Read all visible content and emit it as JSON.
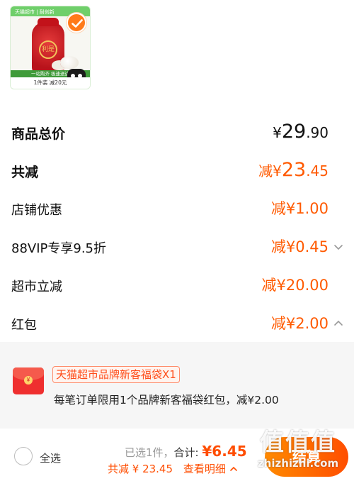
{
  "product": {
    "thumb_top_text": "天猫超市 | 耐创新",
    "thumb_seal_text": "利是",
    "thumb_band_text": "一站购齐 极速送达",
    "thumb_bottom_text": "1件装 减20元"
  },
  "summary_rows": [
    {
      "label": "商品总价",
      "currency": "¥",
      "amount_int": "29",
      "amount_dec": ".90"
    },
    {
      "label": "共减",
      "prefix": "减¥",
      "amount_int": "23",
      "amount_dec": ".45"
    },
    {
      "label": "店铺优惠",
      "amount": "减¥1.00"
    },
    {
      "label": "88VIP专享9.5折",
      "amount": "减¥0.45"
    },
    {
      "label": "超市立减",
      "amount": "减¥20.00"
    },
    {
      "label": "红包",
      "amount": "减¥2.00"
    }
  ],
  "red_packet": {
    "tag": "天猫超市品牌新客福袋X1",
    "description": "每笔订单限用1个品牌新客福袋红包，减¥2.00",
    "icon_glyph": "¥"
  },
  "bottom_bar": {
    "select_all_label": "全选",
    "selected_count": "已选1件，",
    "total_label": "合计:",
    "total_value": "¥6.45",
    "discount_text": "共减 ¥ 23.45",
    "detail_link": "查看明细",
    "checkout_label": "结算",
    "watermark_top": "值值值",
    "watermark_bottom": "zhizhizhi.com"
  },
  "colors": {
    "accent": "#ff5a00",
    "checkout_gradient_start": "#ff8a00",
    "checkout_gradient_end": "#ff4e00",
    "panel_bg": "#f6f6f6"
  }
}
